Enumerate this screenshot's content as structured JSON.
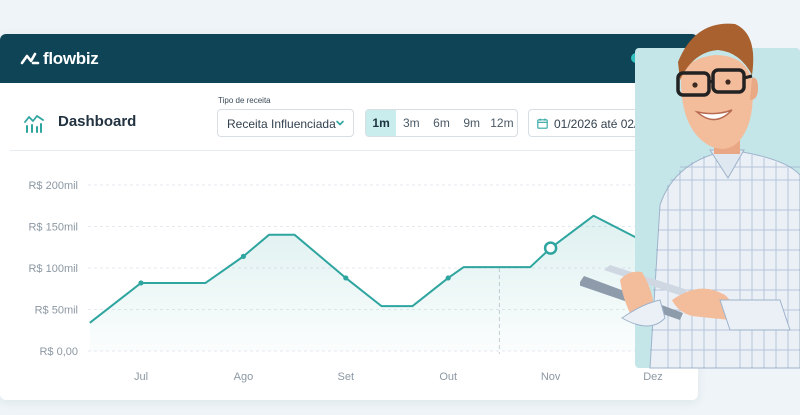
{
  "brand": {
    "name": "flowbiz"
  },
  "colors": {
    "topbar": "#0f4456",
    "accent": "#2fa5a0",
    "active_period": "#c9ecec",
    "background": "#eef4f8"
  },
  "dashboard": {
    "title": "Dashboard",
    "icon": "activity-chart-icon"
  },
  "filters": {
    "revenue_type_label": "Tipo de receita",
    "revenue_type_value": "Receita Influenciada",
    "periods": [
      "1m",
      "3m",
      "6m",
      "9m",
      "12m"
    ],
    "active_period": "1m",
    "date_range": "01/2026 até 02/"
  },
  "chart_data": {
    "type": "line",
    "x": [
      "Jul",
      "Ago",
      "Set",
      "Out",
      "Nov",
      "Dez"
    ],
    "y_ticks": [
      "R$ 200mil",
      "R$ 150mil",
      "R$ 100mil",
      "R$ 50mil",
      "R$ 0,00"
    ],
    "ylim": [
      0,
      200
    ],
    "y_unit": "R$ mil",
    "grid": true,
    "series": [
      {
        "points": [
          {
            "x": -0.5,
            "y": 34
          },
          {
            "x": 0.0,
            "y": 82
          },
          {
            "x": 0.63,
            "y": 82
          },
          {
            "x": 1.0,
            "y": 114
          },
          {
            "x": 1.25,
            "y": 140
          },
          {
            "x": 1.5,
            "y": 140
          },
          {
            "x": 2.0,
            "y": 88
          },
          {
            "x": 2.35,
            "y": 54
          },
          {
            "x": 2.65,
            "y": 54
          },
          {
            "x": 3.0,
            "y": 88
          },
          {
            "x": 3.15,
            "y": 101
          },
          {
            "x": 3.8,
            "y": 101
          },
          {
            "x": 4.0,
            "y": 124
          },
          {
            "x": 4.42,
            "y": 163
          },
          {
            "x": 4.83,
            "y": 137
          }
        ],
        "markers": [
          1,
          3,
          6,
          9
        ],
        "highlight": 12
      }
    ]
  }
}
